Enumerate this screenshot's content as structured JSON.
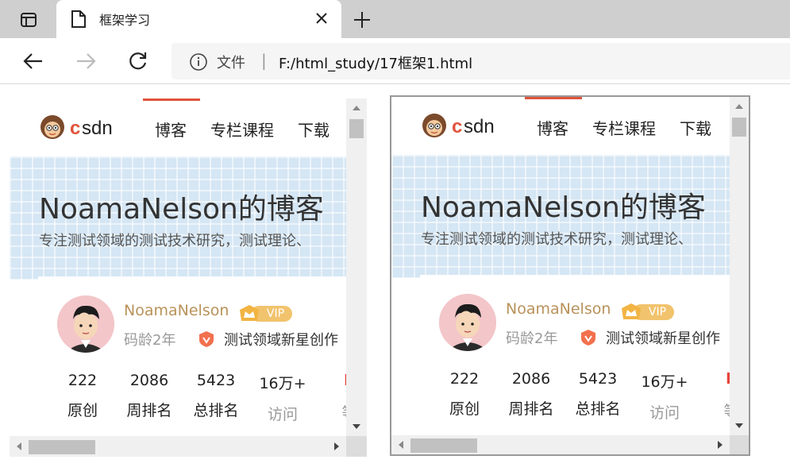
{
  "browser": {
    "tab_title": "框架学习",
    "address_label": "文件",
    "address_sep": "|",
    "url": "F:/html_study/17框架1.html"
  },
  "page": {
    "logo_text": "CSDN",
    "nav": [
      "博客",
      "专栏课程",
      "下载"
    ],
    "blog_title": "NoamaNelson的博客",
    "blog_subtitle": "专注测试领域的测试技术研究，测试理论、",
    "username": "NoamaNelson",
    "vip_label": "VIP",
    "code_age": "码龄2年",
    "medal_text": "测试领域新星创作",
    "stats": [
      {
        "num": "222",
        "label": "原创"
      },
      {
        "num": "2086",
        "label": "周排名"
      },
      {
        "num": "5423",
        "label": "总排名"
      },
      {
        "num": "16万+",
        "label": "访问"
      },
      {
        "num": "",
        "label": "等"
      }
    ]
  },
  "colors": {
    "accent": "#e0533b",
    "username": "#b8925a",
    "vip": "#f2c36d"
  }
}
